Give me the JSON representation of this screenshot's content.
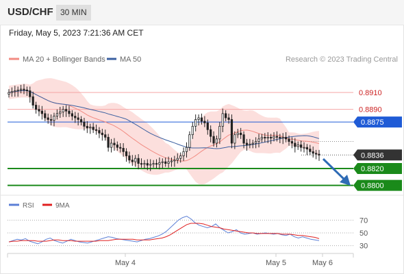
{
  "header": {
    "symbol": "USD/CHF",
    "interval": "30 MIN",
    "datetime": "Friday, May 5, 2023 7:21:36 AM CET"
  },
  "legend": {
    "ma20": "MA 20 + Bollinger Bands",
    "ma50": "MA 50",
    "ma20_color": "#f28b82",
    "ma50_color": "#3a5fa0"
  },
  "credit": "Research © 2023 Trading Central",
  "rsi_legend": {
    "rsi": "RSI",
    "ma9": "9MA",
    "rsi_color": "#5b7fd6",
    "ma9_color": "#e02020"
  },
  "x_labels": [
    "May 4",
    "May 5",
    "May 6"
  ],
  "chart_data": [
    {
      "type": "candlestick",
      "ylim": [
        0.879,
        0.894
      ],
      "price_levels": [
        {
          "value": 0.891,
          "label": "0.8910",
          "style": "resistance",
          "color": "#f5a5a5",
          "text_color": "#cc2222"
        },
        {
          "value": 0.889,
          "label": "0.8890",
          "style": "resistance",
          "color": "#f5a5a5",
          "text_color": "#cc2222"
        },
        {
          "value": 0.8875,
          "label": "0.8875",
          "style": "pivot",
          "color": "#1f5bd6"
        },
        {
          "value": 0.8836,
          "label": "0.8836",
          "style": "last",
          "color": "#333333"
        },
        {
          "value": 0.882,
          "label": "0.8820",
          "style": "target",
          "color": "#1a8a1a"
        },
        {
          "value": 0.88,
          "label": "0.8800",
          "style": "target",
          "color": "#1a8a1a"
        }
      ],
      "close_series": [
        0.891,
        0.8911,
        0.8912,
        0.8913,
        0.8914,
        0.8913,
        0.8912,
        0.8905,
        0.8895,
        0.889,
        0.8888,
        0.8885,
        0.888,
        0.8878,
        0.8877,
        0.8882,
        0.8885,
        0.8887,
        0.889,
        0.8888,
        0.8885,
        0.8882,
        0.888,
        0.8878,
        0.8875,
        0.887,
        0.8868,
        0.8869,
        0.8866,
        0.8865,
        0.8862,
        0.886,
        0.8857,
        0.8845,
        0.885,
        0.8848,
        0.8845,
        0.8844,
        0.884,
        0.8835,
        0.883,
        0.8828,
        0.8832,
        0.8826,
        0.8825,
        0.8826,
        0.8824,
        0.8825,
        0.8826,
        0.8825,
        0.8827,
        0.8828,
        0.8826,
        0.8828,
        0.8829,
        0.883,
        0.8832,
        0.8835,
        0.884,
        0.8845,
        0.886,
        0.887,
        0.8878,
        0.888,
        0.8876,
        0.8874,
        0.8866,
        0.8858,
        0.885,
        0.8855,
        0.887,
        0.8885,
        0.888,
        0.8878,
        0.885,
        0.886,
        0.8862,
        0.886,
        0.885,
        0.8848,
        0.8849,
        0.885,
        0.8852,
        0.8855,
        0.8857,
        0.8856,
        0.8857,
        0.8856,
        0.8858,
        0.8857,
        0.8856,
        0.8857,
        0.8855,
        0.8852,
        0.885,
        0.8846,
        0.8848,
        0.8845,
        0.8845,
        0.8843,
        0.884,
        0.8838,
        0.8837,
        0.8836
      ]
    },
    {
      "type": "line",
      "title": "RSI",
      "ylim": [
        20,
        80
      ],
      "y_ticks": [
        70,
        50,
        30
      ],
      "series": [
        {
          "name": "RSI",
          "values": [
            36,
            38,
            40,
            39,
            41,
            37,
            35,
            33,
            36,
            40,
            42,
            38,
            36,
            34,
            37,
            40,
            38,
            36,
            35,
            34,
            36,
            38,
            40,
            42,
            44,
            43,
            41,
            40,
            39,
            38,
            37,
            36,
            38,
            40,
            41,
            43,
            45,
            48,
            52,
            58,
            64,
            70,
            74,
            76,
            72,
            66,
            62,
            60,
            58,
            60,
            64,
            58,
            54,
            50,
            52,
            55,
            50,
            48,
            49,
            50,
            48,
            49,
            50,
            49,
            48,
            49,
            47,
            46,
            48,
            44,
            42,
            44,
            42,
            40,
            39,
            38
          ]
        },
        {
          "name": "9MA",
          "values": [
            36,
            37,
            37,
            38,
            38,
            38,
            38,
            37,
            37,
            37,
            38,
            39,
            39,
            38,
            38,
            38,
            37,
            37,
            37,
            37,
            37,
            37,
            38,
            38,
            38,
            39,
            40,
            40,
            40,
            40,
            40,
            39,
            39,
            39,
            39,
            40,
            41,
            42,
            44,
            47,
            51,
            55,
            59,
            63,
            65,
            65,
            65,
            64,
            62,
            60,
            59,
            58,
            56,
            55,
            54,
            53,
            52,
            51,
            50,
            50,
            49,
            49,
            49,
            49,
            49,
            49,
            48,
            48,
            48,
            47,
            46,
            46,
            45,
            44,
            43,
            41
          ]
        }
      ]
    }
  ]
}
